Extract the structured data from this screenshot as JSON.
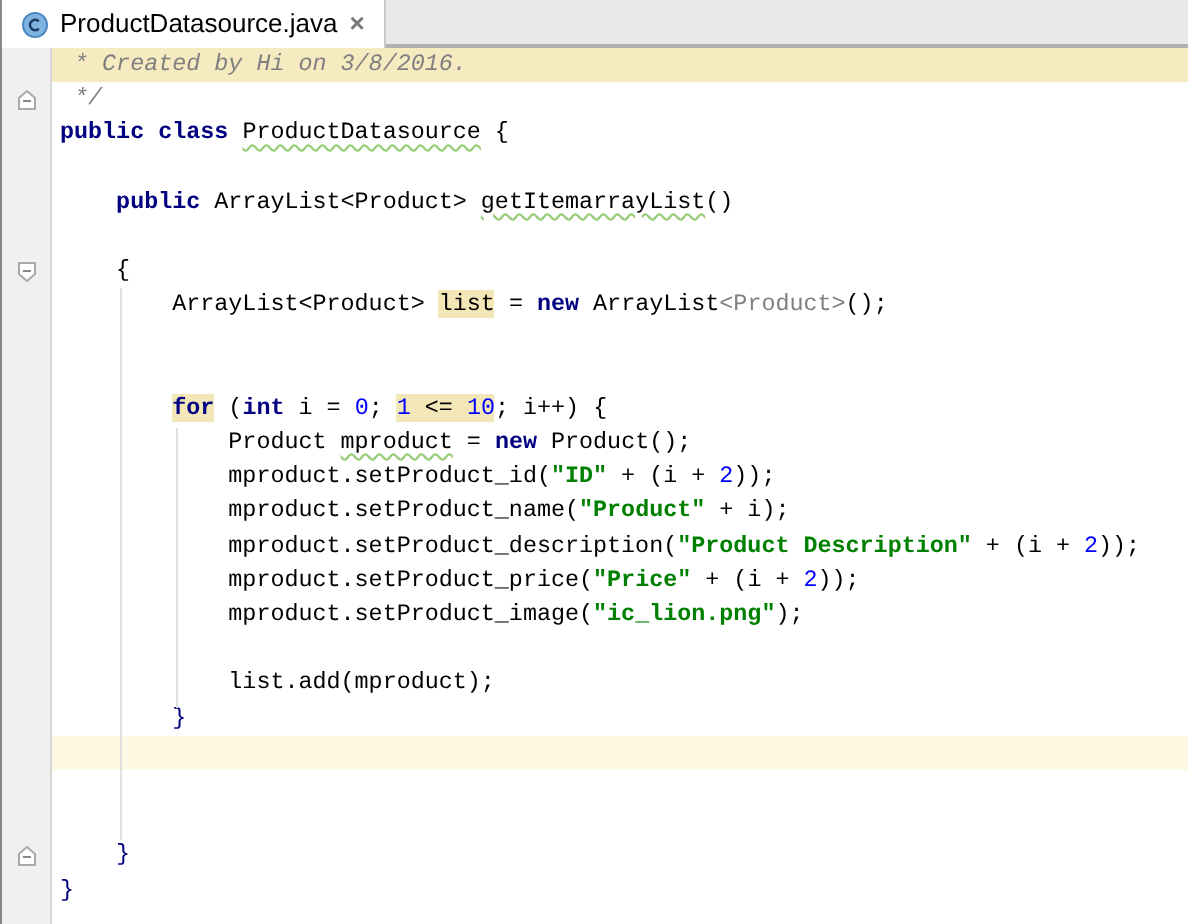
{
  "tabs": [
    {
      "label": "ProductDatasource.java",
      "selected": true,
      "close": "×"
    }
  ],
  "lines": [
    {
      "highlighted": true,
      "tokens": [
        {
          "kind": "comment",
          "text": " * Created by Hi on 3/8/2016."
        }
      ]
    },
    {
      "fold_end": true,
      "tokens": [
        {
          "kind": "comment",
          "text": " */"
        }
      ]
    },
    {
      "tokens": [
        {
          "kind": "keyword",
          "text": "public class "
        },
        {
          "kind": "plain",
          "text": "ProductDatasource",
          "warning": true
        },
        {
          "kind": "plain",
          "text": " {"
        }
      ]
    },
    {
      "kind": "blank"
    },
    {
      "tokens": [
        {
          "kind": "keyword",
          "text": "    public "
        },
        {
          "kind": "plain",
          "text": "ArrayList<Product> "
        },
        {
          "kind": "plain",
          "text": "getItemarrayList",
          "warning": true
        },
        {
          "kind": "plain",
          "text": "()"
        }
      ]
    },
    {
      "kind": "blank"
    },
    {
      "fold_start": true,
      "tokens": [
        {
          "kind": "plain",
          "text": "    {"
        }
      ]
    },
    {
      "tokens": [
        {
          "kind": "plain",
          "text": "        ArrayList<Product> "
        },
        {
          "kind": "plain",
          "text": "list",
          "marked": true
        },
        {
          "kind": "plain",
          "text": " = "
        },
        {
          "kind": "keyword",
          "text": "new "
        },
        {
          "kind": "plain",
          "text": "ArrayList"
        },
        {
          "kind": "inferred",
          "text": "<Product>"
        },
        {
          "kind": "plain",
          "text": "();"
        }
      ]
    },
    {
      "kind": "blank"
    },
    {
      "kind": "blank"
    },
    {
      "tokens": [
        {
          "kind": "keyword",
          "text": "        for",
          "marked": true
        },
        {
          "kind": "plain",
          "text": " ("
        },
        {
          "kind": "keyword",
          "text": "int "
        },
        {
          "kind": "plain",
          "text": "i = "
        },
        {
          "kind": "number",
          "text": "0"
        },
        {
          "kind": "plain",
          "text": "; "
        },
        {
          "kind": "number",
          "text": "1",
          "marked": true
        },
        {
          "kind": "plain",
          "text": " <= ",
          "marked": true
        },
        {
          "kind": "number",
          "text": "10",
          "marked": true
        },
        {
          "kind": "plain",
          "text": "; i++) {"
        }
      ]
    },
    {
      "tokens": [
        {
          "kind": "plain",
          "text": "            Product "
        },
        {
          "kind": "plain",
          "text": "mproduct",
          "warning": true
        },
        {
          "kind": "plain",
          "text": " = "
        },
        {
          "kind": "keyword",
          "text": "new "
        },
        {
          "kind": "plain",
          "text": "Product();"
        }
      ]
    },
    {
      "tokens": [
        {
          "kind": "plain",
          "text": "            mproduct.setProduct_id("
        },
        {
          "kind": "string",
          "text": "\"ID\""
        },
        {
          "kind": "plain",
          "text": " + (i + "
        },
        {
          "kind": "number",
          "text": "2"
        },
        {
          "kind": "plain",
          "text": "));"
        }
      ]
    },
    {
      "tokens": [
        {
          "kind": "plain",
          "text": "            mproduct.setProduct_name("
        },
        {
          "kind": "string",
          "text": "\"Product\""
        },
        {
          "kind": "plain",
          "text": " + i);"
        }
      ]
    },
    {
      "tokens": [
        {
          "kind": "plain",
          "text": "            mproduct.setProduct_description("
        },
        {
          "kind": "string",
          "text": "\"Product Description\""
        },
        {
          "kind": "plain",
          "text": " + (i + "
        },
        {
          "kind": "number",
          "text": "2"
        },
        {
          "kind": "plain",
          "text": "));"
        }
      ]
    },
    {
      "tokens": [
        {
          "kind": "plain",
          "text": "            mproduct.setProduct_price("
        },
        {
          "kind": "string",
          "text": "\"Price\""
        },
        {
          "kind": "plain",
          "text": " + (i + "
        },
        {
          "kind": "number",
          "text": "2"
        },
        {
          "kind": "plain",
          "text": "));"
        }
      ]
    },
    {
      "tokens": [
        {
          "kind": "plain",
          "text": "            mproduct.setProduct_image("
        },
        {
          "kind": "string",
          "text": "\"ic_lion.png\""
        },
        {
          "kind": "plain",
          "text": ");"
        }
      ]
    },
    {
      "kind": "blank"
    },
    {
      "tokens": [
        {
          "kind": "plain",
          "text": "            list.add(mproduct);"
        }
      ]
    },
    {
      "tokens": [
        {
          "kind": "brace",
          "text": "        }"
        }
      ]
    },
    {
      "kind": "blank",
      "current": true
    },
    {
      "kind": "blank"
    },
    {
      "kind": "blank"
    },
    {
      "fold_end": true,
      "tokens": [
        {
          "kind": "brace",
          "text": "    }"
        }
      ]
    },
    {
      "tokens": [
        {
          "kind": "brace",
          "text": "}"
        }
      ]
    }
  ]
}
